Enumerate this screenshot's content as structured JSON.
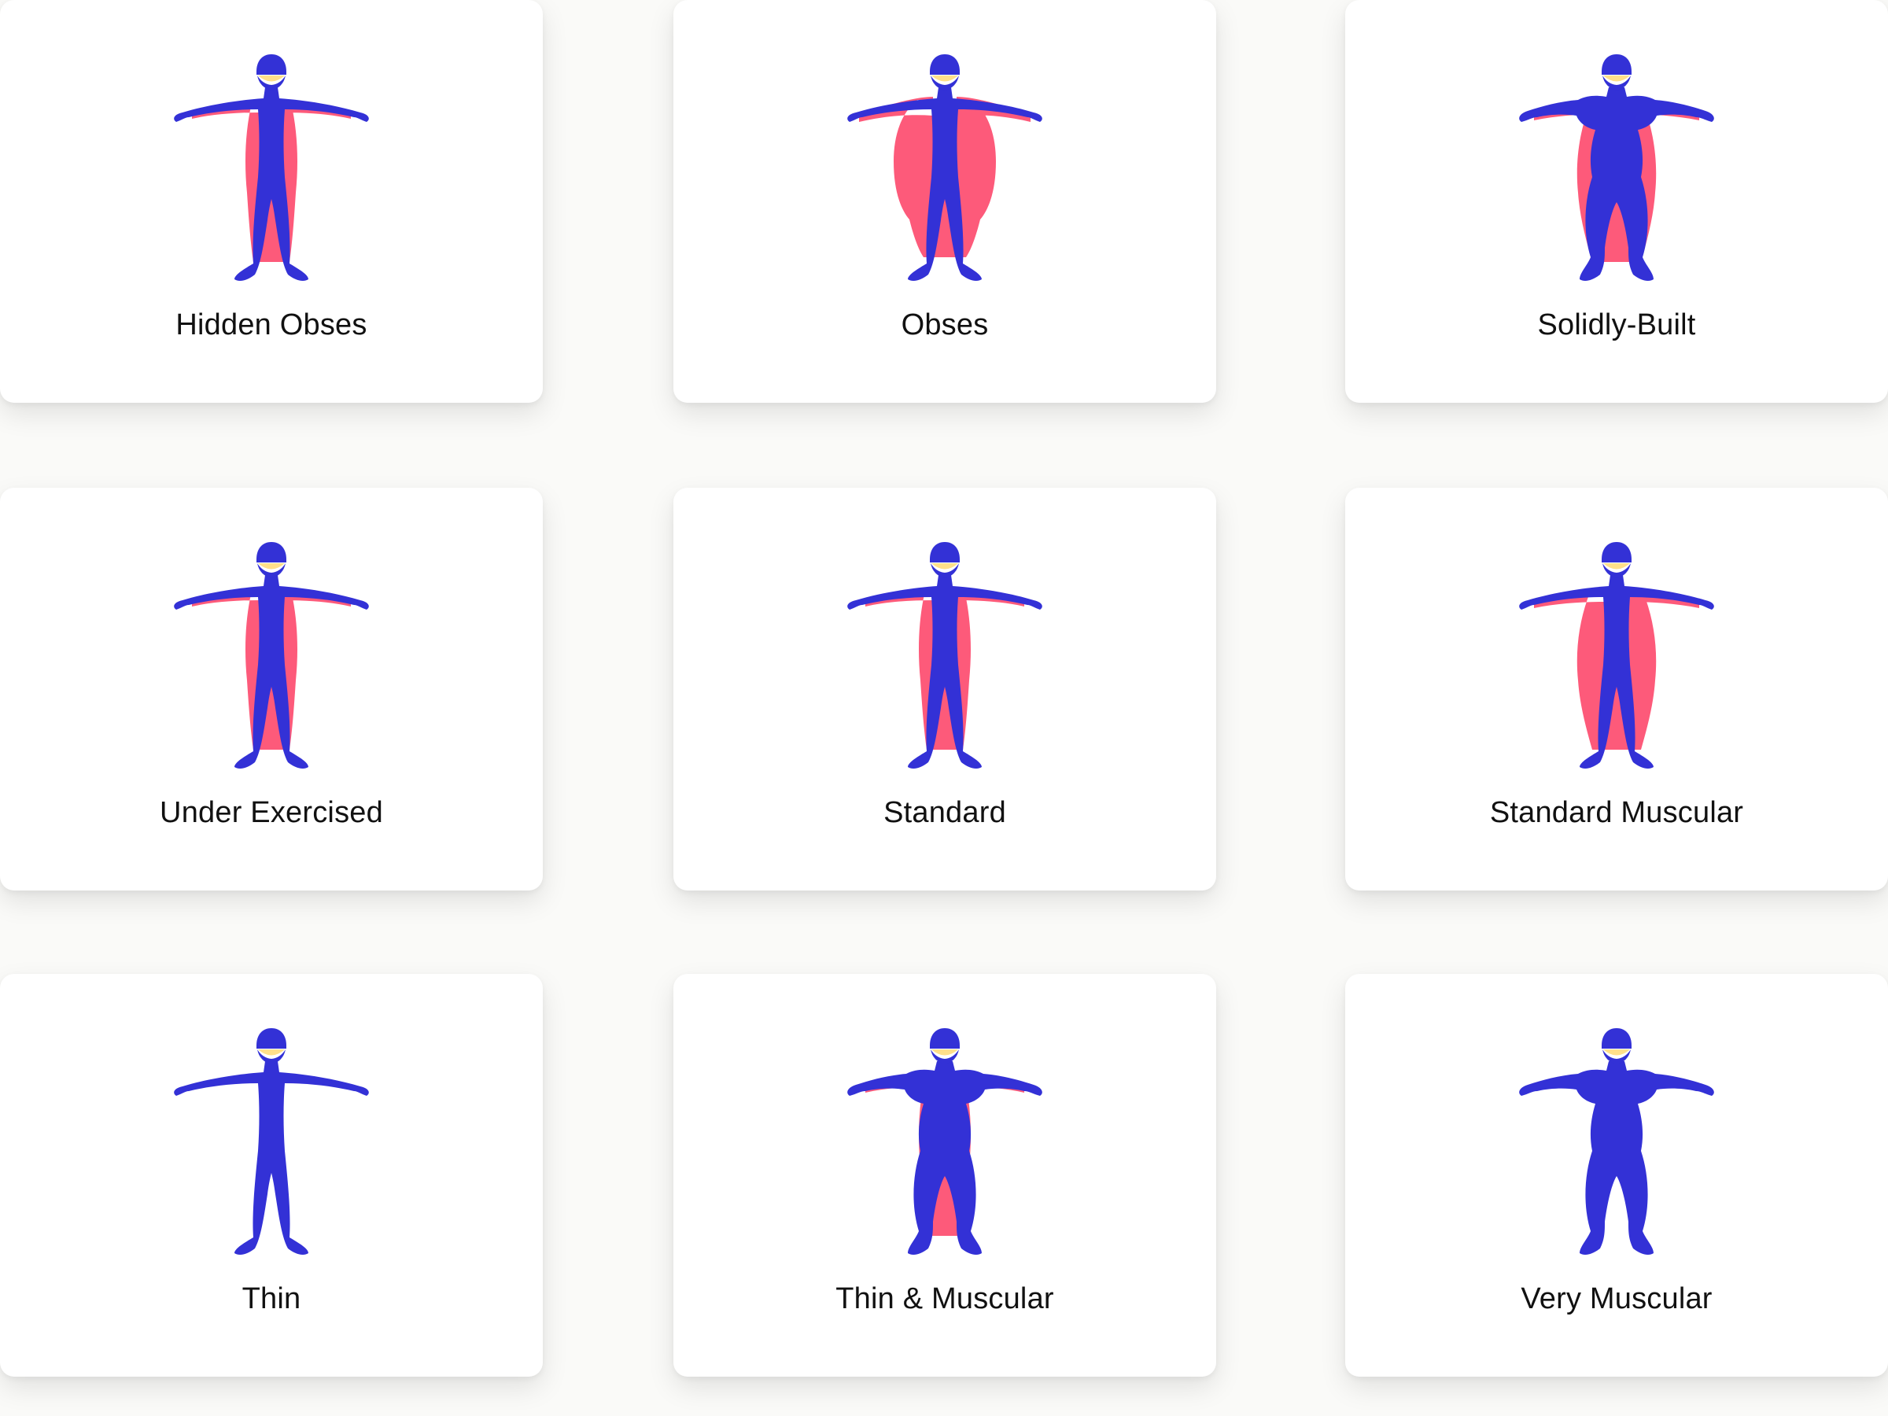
{
  "colors": {
    "background": "#fafaf8",
    "card": "#ffffff",
    "body": "#3331d6",
    "fat": "#fd5a7a",
    "face": "#ffe08a",
    "text": "#111111"
  },
  "body_types": [
    {
      "label": "Hidden Obses",
      "icon": "hidden-obese-figure-icon",
      "fat_level": "low-medium",
      "muscle_level": "low"
    },
    {
      "label": "Obses",
      "icon": "obese-figure-icon",
      "fat_level": "high",
      "muscle_level": "low"
    },
    {
      "label": "Solidly-Built",
      "icon": "solidly-built-figure-icon",
      "fat_level": "medium",
      "muscle_level": "high"
    },
    {
      "label": "Under Exercised",
      "icon": "under-exercised-figure-icon",
      "fat_level": "low-medium",
      "muscle_level": "low"
    },
    {
      "label": "Standard",
      "icon": "standard-figure-icon",
      "fat_level": "low",
      "muscle_level": "medium"
    },
    {
      "label": "Standard Muscular",
      "icon": "standard-muscular-figure-icon",
      "fat_level": "medium",
      "muscle_level": "medium-high"
    },
    {
      "label": "Thin",
      "icon": "thin-figure-icon",
      "fat_level": "none",
      "muscle_level": "low"
    },
    {
      "label": "Thin & Muscular",
      "icon": "thin-muscular-figure-icon",
      "fat_level": "low",
      "muscle_level": "high"
    },
    {
      "label": "Very Muscular",
      "icon": "very-muscular-figure-icon",
      "fat_level": "none",
      "muscle_level": "very-high"
    }
  ]
}
